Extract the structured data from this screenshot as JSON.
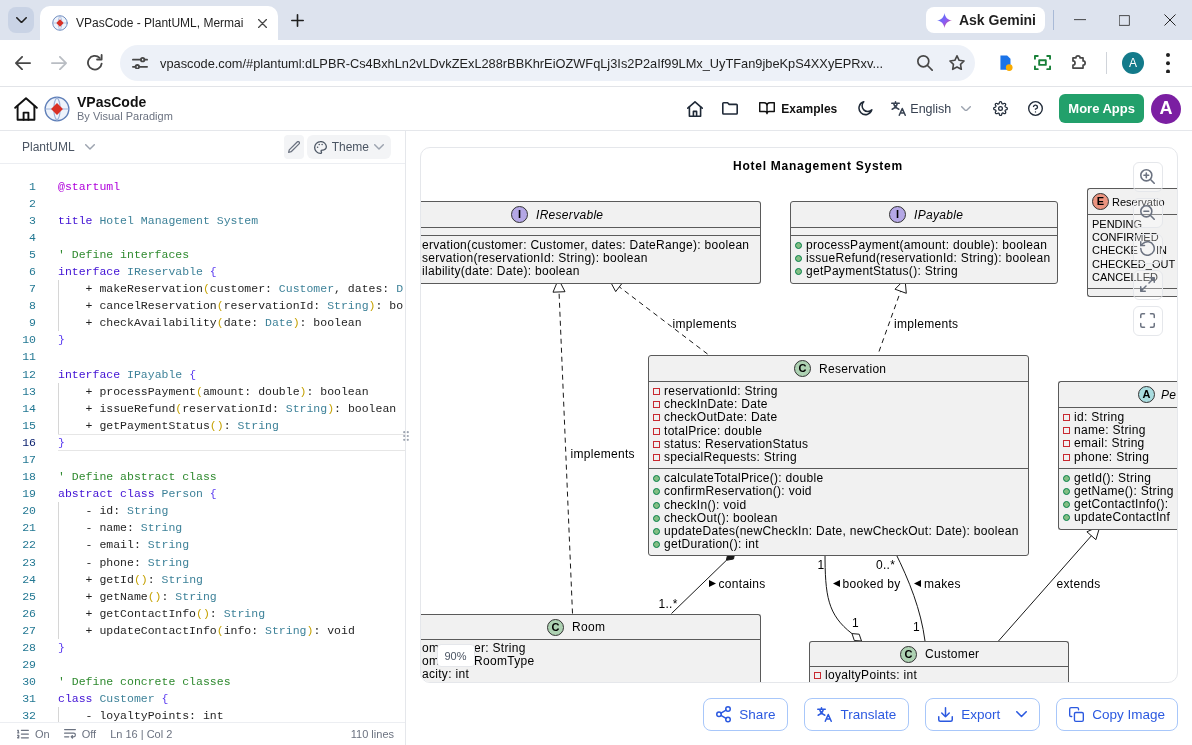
{
  "browser": {
    "tab_title": "VPasCode - PlantUML, Mermai",
    "gemini_button": "Ask Gemini",
    "nav_buttons": [
      {
        "kind": "back",
        "disabled": false
      },
      {
        "kind": "forward",
        "disabled": true
      },
      {
        "kind": "reload",
        "disabled": false
      }
    ],
    "address": "vpascode.com/#plantuml:dLPBR-Cs4BxhLn2vLDvkZExL288rBBKhrEiOZWFqLj3Is2P2aIf99LMx_UyTFan9jbeKpS4XXyEPRxv...",
    "profile_initial": "A"
  },
  "app_header": {
    "brand": "VPasCode",
    "tagline": "By Visual Paradigm",
    "examples_link": "Examples",
    "language": "English",
    "more_apps_button": "More Apps",
    "avatar_initial": "A"
  },
  "editor": {
    "language": "PlantUML",
    "theme_button": "Theme",
    "lines": [
      {
        "number": "1",
        "active": false,
        "tokens": [
          {
            "kind": "directive",
            "text": "@startuml"
          }
        ]
      },
      {
        "number": "2",
        "active": false
      },
      {
        "number": "3",
        "active": false,
        "tokens": [
          {
            "kind": "keyword",
            "text": "title"
          },
          {
            "kind": "type",
            "text": " Hotel Management System"
          }
        ]
      },
      {
        "number": "4",
        "active": false
      },
      {
        "number": "5",
        "active": false,
        "tokens": [
          {
            "kind": "comment",
            "text": "' Define interfaces"
          }
        ]
      },
      {
        "number": "6",
        "active": false,
        "tokens": [
          {
            "kind": "keyword",
            "text": "interface"
          },
          {
            "kind": "type",
            "text": " IReservable"
          },
          {
            "kind": "bracket",
            "text": " {"
          }
        ],
        "children": [
          {
            "number": "7",
            "active": false,
            "tokens": [
              {
                "kind": "plain",
                "text": "+ makeReservation"
              },
              {
                "kind": "paren",
                "text": "("
              },
              {
                "kind": "plain",
                "text": "customer: "
              },
              {
                "kind": "type",
                "text": "Customer"
              },
              {
                "kind": "plain",
                "text": ", dates: "
              },
              {
                "kind": "type",
                "text": "D"
              }
            ]
          },
          {
            "number": "8",
            "active": false,
            "tokens": [
              {
                "kind": "plain",
                "text": "+ cancelReservation"
              },
              {
                "kind": "paren",
                "text": "("
              },
              {
                "kind": "plain",
                "text": "reservationId: "
              },
              {
                "kind": "type",
                "text": "String"
              },
              {
                "kind": "paren",
                "text": ")"
              },
              {
                "kind": "plain",
                "text": ": bo"
              }
            ]
          },
          {
            "number": "9",
            "active": false,
            "tokens": [
              {
                "kind": "plain",
                "text": "+ checkAvailability"
              },
              {
                "kind": "paren",
                "text": "("
              },
              {
                "kind": "plain",
                "text": "date: "
              },
              {
                "kind": "type",
                "text": "Date"
              },
              {
                "kind": "paren",
                "text": ")"
              },
              {
                "kind": "plain",
                "text": ": boolean"
              }
            ]
          }
        ]
      },
      {
        "number": "10",
        "active": false,
        "tokens": [
          {
            "kind": "bracket",
            "text": "}"
          }
        ]
      },
      {
        "number": "11",
        "active": false
      },
      {
        "number": "12",
        "active": false,
        "tokens": [
          {
            "kind": "keyword",
            "text": "interface"
          },
          {
            "kind": "type",
            "text": " IPayable"
          },
          {
            "kind": "bracket",
            "text": " {"
          }
        ],
        "children": [
          {
            "number": "13",
            "active": false,
            "tokens": [
              {
                "kind": "plain",
                "text": "+ processPayment"
              },
              {
                "kind": "paren",
                "text": "("
              },
              {
                "kind": "plain",
                "text": "amount: double"
              },
              {
                "kind": "paren",
                "text": ")"
              },
              {
                "kind": "plain",
                "text": ": boolean"
              }
            ]
          },
          {
            "number": "14",
            "active": false,
            "tokens": [
              {
                "kind": "plain",
                "text": "+ issueRefund"
              },
              {
                "kind": "paren",
                "text": "("
              },
              {
                "kind": "plain",
                "text": "reservationId: "
              },
              {
                "kind": "type",
                "text": "String"
              },
              {
                "kind": "paren",
                "text": ")"
              },
              {
                "kind": "plain",
                "text": ": boolean"
              }
            ]
          },
          {
            "number": "15",
            "active": false,
            "tokens": [
              {
                "kind": "plain",
                "text": "+ getPaymentStatus"
              },
              {
                "kind": "paren",
                "text": "()"
              },
              {
                "kind": "plain",
                "text": ": "
              },
              {
                "kind": "type",
                "text": "String"
              }
            ]
          }
        ]
      },
      {
        "number": "16",
        "active": true,
        "tokens": [
          {
            "kind": "bracket",
            "text": "}"
          }
        ]
      },
      {
        "number": "17",
        "active": false
      },
      {
        "number": "18",
        "active": false,
        "tokens": [
          {
            "kind": "comment",
            "text": "' Define abstract class"
          }
        ]
      },
      {
        "number": "19",
        "active": false,
        "tokens": [
          {
            "kind": "keyword",
            "text": "abstract class"
          },
          {
            "kind": "type",
            "text": " Person"
          },
          {
            "kind": "bracket",
            "text": " {"
          }
        ],
        "children": [
          {
            "number": "20",
            "active": false,
            "tokens": [
              {
                "kind": "plain",
                "text": "- id: "
              },
              {
                "kind": "type",
                "text": "String"
              }
            ]
          },
          {
            "number": "21",
            "active": false,
            "tokens": [
              {
                "kind": "plain",
                "text": "- name: "
              },
              {
                "kind": "type",
                "text": "String"
              }
            ]
          },
          {
            "number": "22",
            "active": false,
            "tokens": [
              {
                "kind": "plain",
                "text": "- email: "
              },
              {
                "kind": "type",
                "text": "String"
              }
            ]
          },
          {
            "number": "23",
            "active": false,
            "tokens": [
              {
                "kind": "plain",
                "text": "- phone: "
              },
              {
                "kind": "type",
                "text": "String"
              }
            ]
          },
          {
            "number": "24",
            "active": false,
            "tokens": [
              {
                "kind": "plain",
                "text": "+ getId"
              },
              {
                "kind": "paren",
                "text": "()"
              },
              {
                "kind": "plain",
                "text": ": "
              },
              {
                "kind": "type",
                "text": "String"
              }
            ]
          },
          {
            "number": "25",
            "active": false,
            "tokens": [
              {
                "kind": "plain",
                "text": "+ getName"
              },
              {
                "kind": "paren",
                "text": "()"
              },
              {
                "kind": "plain",
                "text": ": "
              },
              {
                "kind": "type",
                "text": "String"
              }
            ]
          },
          {
            "number": "26",
            "active": false,
            "tokens": [
              {
                "kind": "plain",
                "text": "+ getContactInfo"
              },
              {
                "kind": "paren",
                "text": "()"
              },
              {
                "kind": "plain",
                "text": ": "
              },
              {
                "kind": "type",
                "text": "String"
              }
            ]
          },
          {
            "number": "27",
            "active": false,
            "tokens": [
              {
                "kind": "plain",
                "text": "+ updateContactInfo"
              },
              {
                "kind": "paren",
                "text": "("
              },
              {
                "kind": "plain",
                "text": "info: "
              },
              {
                "kind": "type",
                "text": "String"
              },
              {
                "kind": "paren",
                "text": ")"
              },
              {
                "kind": "plain",
                "text": ": void"
              }
            ]
          }
        ]
      },
      {
        "number": "28",
        "active": false,
        "tokens": [
          {
            "kind": "bracket",
            "text": "}"
          }
        ]
      },
      {
        "number": "29",
        "active": false
      },
      {
        "number": "30",
        "active": false,
        "tokens": [
          {
            "kind": "comment",
            "text": "' Define concrete classes"
          }
        ]
      },
      {
        "number": "31",
        "active": false,
        "tokens": [
          {
            "kind": "keyword",
            "text": "class"
          },
          {
            "kind": "type",
            "text": " Customer"
          },
          {
            "kind": "bracket",
            "text": " {"
          }
        ],
        "children": [
          {
            "number": "32",
            "active": false,
            "tokens": [
              {
                "kind": "plain",
                "text": "- loyaltyPoints: int"
              }
            ]
          }
        ]
      }
    ],
    "status_bar": {
      "line_numbers": "On",
      "word_wrap": "Off",
      "cursor_position": "Ln 16 | Col 2",
      "line_count": "110 lines"
    }
  },
  "diagram": {
    "title": "Hotel Management System",
    "nodes": [
      {
        "kind": "interface",
        "badge": "I",
        "name": "IReservable",
        "methods": [
          {
            "text": "ervation(customer: Customer, dates: DateRange): boolean"
          },
          {
            "text": "servation(reservationId: String): boolean"
          },
          {
            "text": "ilability(date: Date): boolean"
          }
        ]
      },
      {
        "kind": "interface",
        "badge": "I",
        "name": "IPayable",
        "methods": [
          {
            "text": "processPayment(amount: double): boolean",
            "kind": "public"
          },
          {
            "text": "issueRefund(reservationId: String): boolean",
            "kind": "public"
          },
          {
            "text": "getPaymentStatus(): String",
            "kind": "public"
          }
        ]
      },
      {
        "kind": "enum",
        "badge": "E",
        "name": "Reservatio",
        "attributes": [
          {
            "text": "PENDING"
          },
          {
            "text": "CONFIRMED"
          },
          {
            "text": "CHECKE",
            "text_after_overlay": "IN"
          },
          {
            "text": "CHECKED_OUT"
          },
          {
            "text": "CANCELLED"
          }
        ]
      },
      {
        "kind": "class",
        "badge": "C",
        "name": "Reservation",
        "attributes": [
          {
            "text": "reservationId: String",
            "kind": "private"
          },
          {
            "text": "checkInDate: Date",
            "kind": "private"
          },
          {
            "text": "checkOutDate: Date",
            "kind": "private"
          },
          {
            "text": "totalPrice: double",
            "kind": "private"
          },
          {
            "text": "status: ReservationStatus",
            "kind": "private"
          },
          {
            "text": "specialRequests: String",
            "kind": "private"
          }
        ],
        "methods": [
          {
            "text": "calculateTotalPrice(): double",
            "kind": "public"
          },
          {
            "text": "confirmReservation(): void",
            "kind": "public"
          },
          {
            "text": "checkIn(): void",
            "kind": "public"
          },
          {
            "text": "checkOut(): boolean",
            "kind": "public"
          },
          {
            "text": "updateDates(newCheckIn: Date, newCheckOut: Date): boolean",
            "kind": "public"
          },
          {
            "text": "getDuration(): int",
            "kind": "public"
          }
        ]
      },
      {
        "kind": "abstract",
        "badge": "A",
        "name": "Pe",
        "attributes": [
          {
            "text": "id: String",
            "kind": "private"
          },
          {
            "text": "name: String",
            "kind": "private"
          },
          {
            "text": "email: String",
            "kind": "private"
          },
          {
            "text": "phone: String",
            "kind": "private"
          }
        ],
        "methods": [
          {
            "text": "getId(): String",
            "kind": "public"
          },
          {
            "text": "getName(): String",
            "kind": "public"
          },
          {
            "text": "getContactInfo():",
            "kind": "public"
          },
          {
            "text": "updateContactInf",
            "kind": "public"
          }
        ]
      },
      {
        "kind": "class",
        "badge": "C",
        "name": "Room",
        "attributes": [
          {
            "text": "om",
            "text_after_overlay": "er: String"
          },
          {
            "text": "om",
            "text_after_overlay": "RoomType"
          },
          {
            "text": "acity: int"
          }
        ]
      },
      {
        "kind": "class",
        "badge": "C",
        "name": "Customer",
        "attributes": [
          {
            "text": "loyaltyPoints: int",
            "kind": "private"
          }
        ]
      }
    ],
    "relations": [
      {
        "kind": "realization",
        "label": "implements"
      },
      {
        "kind": "realization",
        "label": "implements"
      },
      {
        "kind": "realization",
        "label": "implements"
      },
      {
        "kind": "composition",
        "label": "contains",
        "label_arrow": {
          "kind": "right"
        },
        "start_multiplicity": "1..*"
      },
      {
        "kind": "aggregation",
        "label": "booked by",
        "label_arrow": {
          "kind": "left"
        },
        "start_multiplicity": "1",
        "end_multiplicity": "1"
      },
      {
        "kind": "association",
        "label": "makes",
        "label_arrow": {
          "kind": "left"
        },
        "start_multiplicity": "0..*",
        "end_multiplicity": "1"
      },
      {
        "kind": "generalization",
        "label": "extends"
      }
    ],
    "zoom_level": "90%"
  },
  "actions": [
    {
      "kind": "share",
      "label": "Share",
      "dropdown": false
    },
    {
      "kind": "translate",
      "label": "Translate",
      "dropdown": false
    },
    {
      "kind": "export",
      "label": "Export",
      "dropdown": true
    },
    {
      "kind": "copy",
      "label": "Copy Image",
      "dropdown": false
    }
  ]
}
